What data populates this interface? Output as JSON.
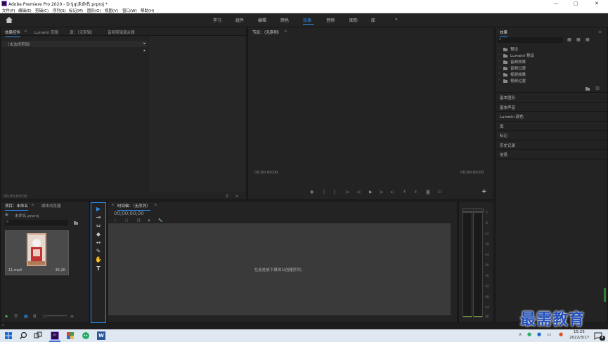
{
  "window": {
    "title": "Adobe Premiere Pro 2020 - D:\\jq\\未命名.prproj *",
    "controls": [
      "—",
      "▢",
      "✕"
    ]
  },
  "menu": [
    "文件(F)",
    "编辑(E)",
    "剪辑(C)",
    "序列(S)",
    "标记(M)",
    "图形(G)",
    "视图(V)",
    "窗口(W)",
    "帮助(H)"
  ],
  "workspaces": {
    "items": [
      "学习",
      "组件",
      "编辑",
      "颜色",
      "效果",
      "音频",
      "图形",
      "库"
    ],
    "active": "效果",
    "more": "»"
  },
  "source_panel": {
    "tabs": [
      "效果控件",
      "Lumetri 范围",
      "源：（无剪辑）",
      "音频剪辑混合器"
    ],
    "menu_glyph": "≡",
    "no_clip": "（未选择剪辑）",
    "timecode": "00;00;00;00"
  },
  "program": {
    "title": "节目：（无序列）",
    "menu_glyph": "≡",
    "timecode_left": "00;00;00;00",
    "timecode_right": "00;00;00;00",
    "add": "+"
  },
  "effects": {
    "title": "效果",
    "menu_glyph": "≡",
    "tree": [
      "预设",
      "Lumetri 预设",
      "音频效果",
      "音频过渡",
      "视频效果",
      "视频过渡"
    ],
    "sections": [
      "基本图形",
      "基本声音",
      "Lumetri 颜色",
      "库",
      "标记",
      "历史记录",
      "信息"
    ]
  },
  "project": {
    "tabs": [
      "项目：未命名",
      "媒体浏览器"
    ],
    "menu_glyph": "≡",
    "file": "未命名.prproj",
    "clip_name": "11.mp4",
    "clip_duration": "35;20"
  },
  "timeline": {
    "close": "×",
    "title": "时间轴：（无序列）",
    "menu_glyph": "≡",
    "timecode": "00;00;00;00",
    "drop_hint": "在此处放下媒体以创建序列。"
  },
  "audio_meter": {
    "ticks": [
      "0",
      "-6",
      "-12",
      "-18",
      "-24",
      "-30",
      "-36",
      "-42",
      "-48",
      "-54",
      "dB"
    ]
  },
  "tools": [
    "▶",
    "⇥",
    "⇔",
    "◆",
    "↔",
    "✎",
    "✋",
    "T"
  ],
  "taskbar": {
    "time": "15:25",
    "date": "2022/3/17",
    "badge": "4"
  },
  "watermark": "最需教育",
  "colors": {
    "accent": "#2d8ceb",
    "panel": "#232323",
    "background": "#1d1d1d",
    "premiere": "#2b0a3d"
  }
}
